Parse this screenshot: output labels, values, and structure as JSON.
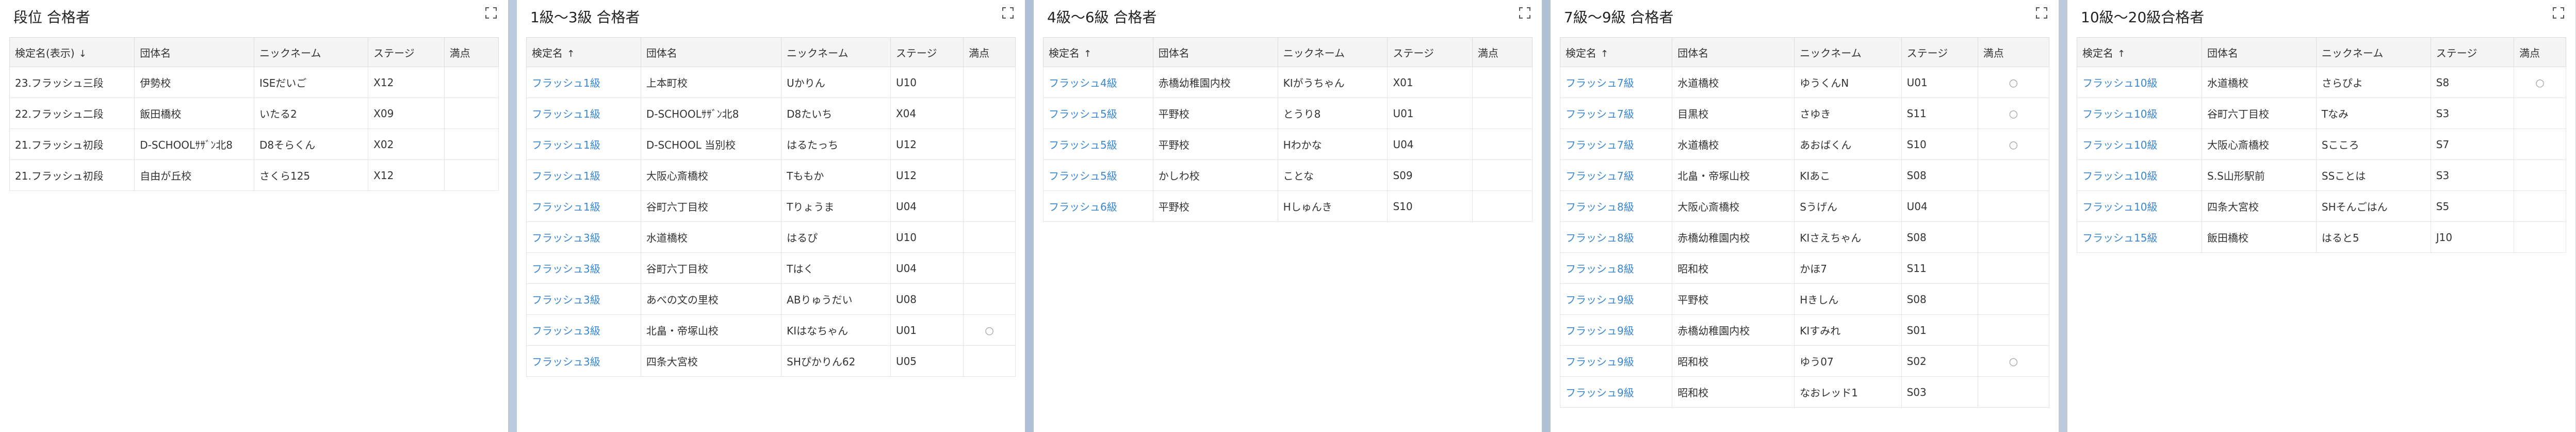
{
  "panels": [
    {
      "title": "段位 合格者",
      "grade_link": false,
      "columns": [
        "検定名(表示)",
        "団体名",
        "ニックネーム",
        "ステージ",
        "満点"
      ],
      "sort_dir": "↓",
      "rows": [
        [
          "23.フラッシュ三段",
          "伊勢校",
          "ISEだいご",
          "X12",
          ""
        ],
        [
          "22.フラッシュ二段",
          "飯田橋校",
          "いたる2",
          "X09",
          ""
        ],
        [
          "21.フラッシュ初段",
          "D-SCHOOLｻｻﾞﾝ北8",
          "D8そらくん",
          "X02",
          ""
        ],
        [
          "21.フラッシュ初段",
          "自由が丘校",
          "さくら125",
          "X12",
          ""
        ]
      ]
    },
    {
      "title": "1級～3級 合格者",
      "grade_link": true,
      "columns": [
        "検定名",
        "団体名",
        "ニックネーム",
        "ステージ",
        "満点"
      ],
      "sort_dir": "↑",
      "rows": [
        [
          "フラッシュ1級",
          "上本町校",
          "Uかりん",
          "U10",
          ""
        ],
        [
          "フラッシュ1級",
          "D-SCHOOLｻｻﾞﾝ北8",
          "D8たいち",
          "X04",
          ""
        ],
        [
          "フラッシュ1級",
          "D-SCHOOL 当別校",
          "はるたっち",
          "U12",
          ""
        ],
        [
          "フラッシュ1級",
          "大阪心斎橋校",
          "Tももか",
          "U12",
          ""
        ],
        [
          "フラッシュ1級",
          "谷町六丁目校",
          "Tりょうま",
          "U04",
          ""
        ],
        [
          "フラッシュ3級",
          "水道橋校",
          "はるぴ",
          "U10",
          ""
        ],
        [
          "フラッシュ3級",
          "谷町六丁目校",
          "Tはく",
          "U04",
          ""
        ],
        [
          "フラッシュ3級",
          "あべの文の里校",
          "ABりゅうだい",
          "U08",
          ""
        ],
        [
          "フラッシュ3級",
          "北畠・帝塚山校",
          "KIはなちゃん",
          "U01",
          "○"
        ],
        [
          "フラッシュ3級",
          "四条大宮校",
          "SHぴかりん62",
          "U05",
          ""
        ]
      ]
    },
    {
      "title": "4級～6級 合格者",
      "grade_link": true,
      "columns": [
        "検定名",
        "団体名",
        "ニックネーム",
        "ステージ",
        "満点"
      ],
      "sort_dir": "↑",
      "rows": [
        [
          "フラッシュ4級",
          "赤橋幼稚園内校",
          "KIがうちゃん",
          "X01",
          ""
        ],
        [
          "フラッシュ5級",
          "平野校",
          "とうり8",
          "U01",
          ""
        ],
        [
          "フラッシュ5級",
          "平野校",
          "Hわかな",
          "U04",
          ""
        ],
        [
          "フラッシュ5級",
          "かしわ校",
          "ことな",
          "S09",
          ""
        ],
        [
          "フラッシュ6級",
          "平野校",
          "Hしゅんき",
          "S10",
          ""
        ]
      ]
    },
    {
      "title": "7級～9級 合格者",
      "grade_link": true,
      "columns": [
        "検定名",
        "団体名",
        "ニックネーム",
        "ステージ",
        "満点"
      ],
      "sort_dir": "↑",
      "rows": [
        [
          "フラッシュ7級",
          "水道橋校",
          "ゆうくんN",
          "U01",
          "○"
        ],
        [
          "フラッシュ7級",
          "目黒校",
          "さゆき",
          "S11",
          "○"
        ],
        [
          "フラッシュ7級",
          "水道橋校",
          "あおばくん",
          "S10",
          "○"
        ],
        [
          "フラッシュ7級",
          "北畠・帝塚山校",
          "KIあこ",
          "S08",
          ""
        ],
        [
          "フラッシュ8級",
          "大阪心斎橋校",
          "Sうげん",
          "U04",
          ""
        ],
        [
          "フラッシュ8級",
          "赤橋幼稚園内校",
          "KIさえちゃん",
          "S08",
          ""
        ],
        [
          "フラッシュ8級",
          "昭和校",
          "かほ7",
          "S11",
          ""
        ],
        [
          "フラッシュ9級",
          "平野校",
          "Hきしん",
          "S08",
          ""
        ],
        [
          "フラッシュ9級",
          "赤橋幼稚園内校",
          "KIすみれ",
          "S01",
          ""
        ],
        [
          "フラッシュ9級",
          "昭和校",
          "ゆう07",
          "S02",
          "○"
        ],
        [
          "フラッシュ9級",
          "昭和校",
          "なおレッド1",
          "S03",
          ""
        ]
      ]
    },
    {
      "title": "10級～20級合格者",
      "grade_link": true,
      "columns": [
        "検定名",
        "団体名",
        "ニックネーム",
        "ステージ",
        "満点"
      ],
      "sort_dir": "↑",
      "rows": [
        [
          "フラッシュ10級",
          "水道橋校",
          "さらぴよ",
          "S8",
          "○"
        ],
        [
          "フラッシュ10級",
          "谷町六丁目校",
          "Tなみ",
          "S3",
          ""
        ],
        [
          "フラッシュ10級",
          "大阪心斎橋校",
          "Sこころ",
          "S7",
          ""
        ],
        [
          "フラッシュ10級",
          "S.S山形駅前",
          "SSことは",
          "S3",
          ""
        ],
        [
          "フラッシュ10級",
          "四条大宮校",
          "SHそんごはん",
          "S5",
          ""
        ],
        [
          "フラッシュ15級",
          "飯田橋校",
          "はると5",
          "J10",
          ""
        ]
      ]
    }
  ]
}
